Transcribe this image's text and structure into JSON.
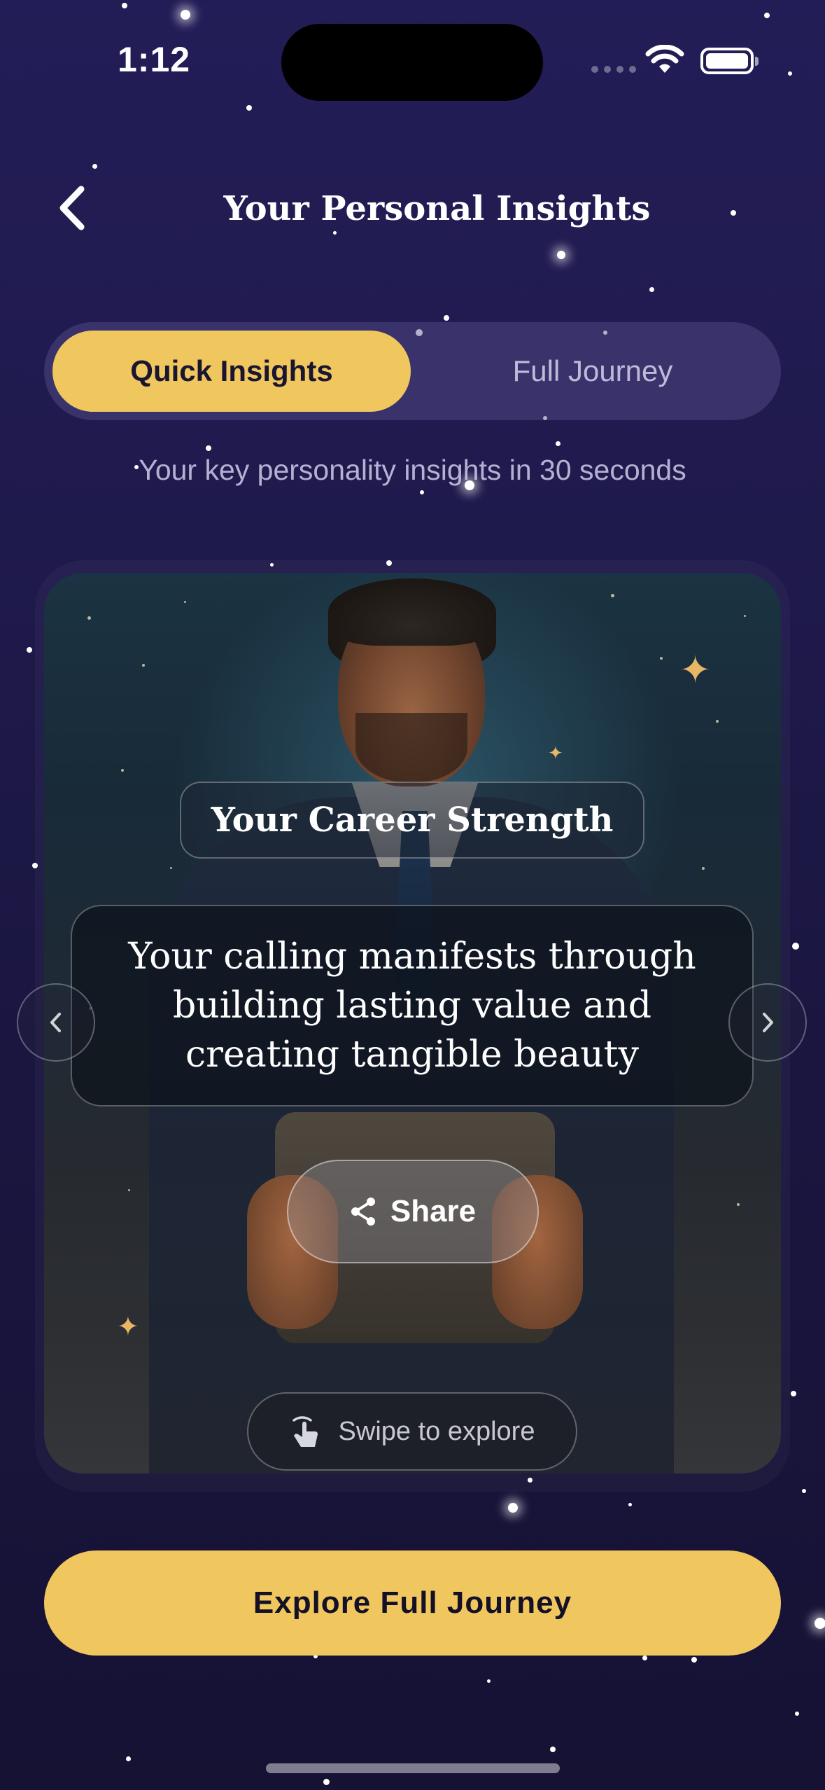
{
  "status_bar": {
    "time": "1:12"
  },
  "header": {
    "title": "Your Personal Insights"
  },
  "tabs": [
    {
      "label": "Quick Insights",
      "active": true
    },
    {
      "label": "Full Journey",
      "active": false
    }
  ],
  "subtitle": "Your key personality insights in 30 seconds",
  "card": {
    "title": "Your Career Strength",
    "quote": "Your calling manifests through building lasting value and creating tangible beauty",
    "share_label": "Share",
    "swipe_hint": "Swipe to explore"
  },
  "cta_label": "Explore Full Journey",
  "colors": {
    "accent": "#f0c65f",
    "background": "#1f1a4c"
  },
  "icons": [
    "back-chevron-icon",
    "wifi-icon",
    "battery-icon",
    "share-icon",
    "swipe-hand-icon",
    "chevron-left-icon",
    "chevron-right-icon"
  ]
}
